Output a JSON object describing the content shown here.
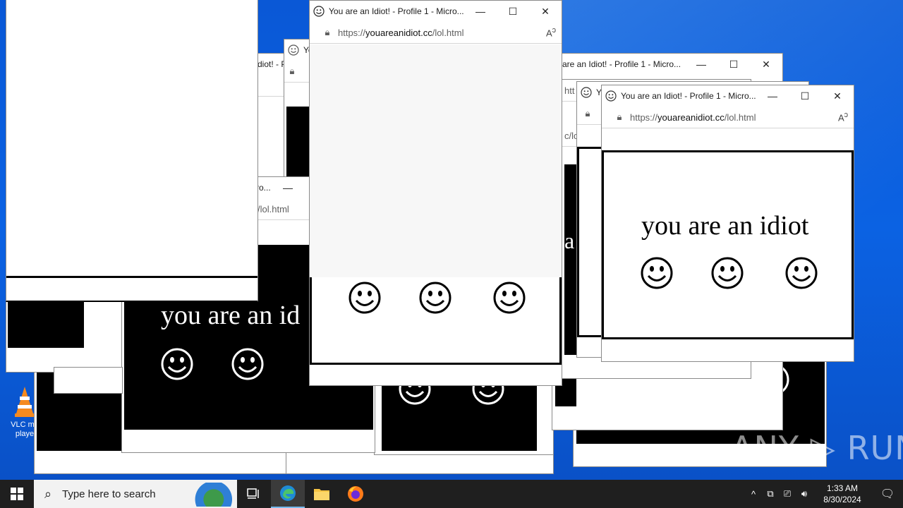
{
  "desktop": {
    "icon_label": "VLC media player",
    "icon_label_visible": "VLC me\nplaye",
    "watermark": "ANY ▷ RUN"
  },
  "window": {
    "title": "You are an Idiot! - Profile 1 - Micro...",
    "title_fragment_a": "are an Idiot! - Profile 1 - Micro...",
    "title_fragment_b": "Yo",
    "title_fragment_c": "ro...",
    "title_fragment_d": "diot! - P",
    "url_prefix": "https://",
    "url_domain": "youareanidiot.cc",
    "url_path": "/lol.html",
    "url_fragment": "/lol.html",
    "url_fragment_b": "htt",
    "url_fragment_c": "c/lo",
    "minimize_icon": "minimize-icon",
    "maximize_icon": "maximize-icon",
    "close_icon": "close-icon"
  },
  "content": {
    "message": "you are an idiot",
    "message_partial": "you are an id",
    "message_fragment": "a"
  },
  "taskbar": {
    "search_placeholder": "Type here to search",
    "time": "1:33 AM",
    "date": "8/30/2024"
  },
  "colors": {
    "wallpaper": "#0b62e3",
    "taskbar": "#1f1f1f",
    "accent": "#76b9ed"
  }
}
